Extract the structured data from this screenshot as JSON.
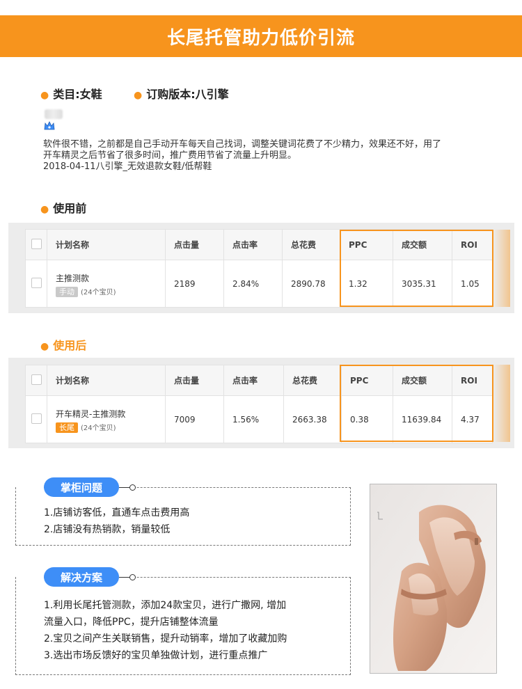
{
  "banner": {
    "title": "长尾托管助力低价引流"
  },
  "meta": {
    "category": "类目:女鞋",
    "version": "订购版本:八引擎"
  },
  "review": {
    "line1": "软件很不错，之前都是自己手动开车每天自己找词，调整关键词花费了不少精力，效果还不好，用了",
    "line2": "开车精灵之后节省了很多时间，推广费用节省了流量上升明显。",
    "line3": "2018-04-11八引擎_无效退款女鞋/低帮鞋"
  },
  "before": {
    "title": "使用前",
    "headers": [
      "计划名称",
      "点击量",
      "点击率",
      "总花费",
      "PPC",
      "成交额",
      "ROI"
    ],
    "row": {
      "name": "主推测款",
      "tag": "手动",
      "count": "(24个宝贝)",
      "clicks": "2189",
      "ctr": "2.84%",
      "cost": "2890.78",
      "ppc": "1.32",
      "sales": "3035.31",
      "roi": "1.05"
    }
  },
  "after": {
    "title": "使用后",
    "headers": [
      "计划名称",
      "点击量",
      "点击率",
      "总花费",
      "PPC",
      "成交额",
      "ROI"
    ],
    "row": {
      "name": "开车精灵-主推测款",
      "tag": "长尾",
      "count": "(24个宝贝)",
      "clicks": "7009",
      "ctr": "1.56%",
      "cost": "2663.38",
      "ppc": "0.38",
      "sales": "11639.84",
      "roi": "4.37"
    }
  },
  "problems": {
    "title": "掌柜问题",
    "items": [
      "1.店铺访客低，直通车点击费用高",
      "2.店铺没有热销款，销量较低"
    ]
  },
  "solutions": {
    "title": "解决方案",
    "items": [
      "1.利用长尾托管测款，添加24款宝贝，进行广撒网, 增加",
      "流量入口，降低PPC，提升店铺整体流量",
      "2.宝贝之间产生关联销售，提升动销率，增加了收藏加购",
      "3.选出市场反馈好的宝贝单独做计划，进行重点推广"
    ]
  },
  "colors": {
    "accent": "#f7941d",
    "blue": "#3e8ef7"
  }
}
